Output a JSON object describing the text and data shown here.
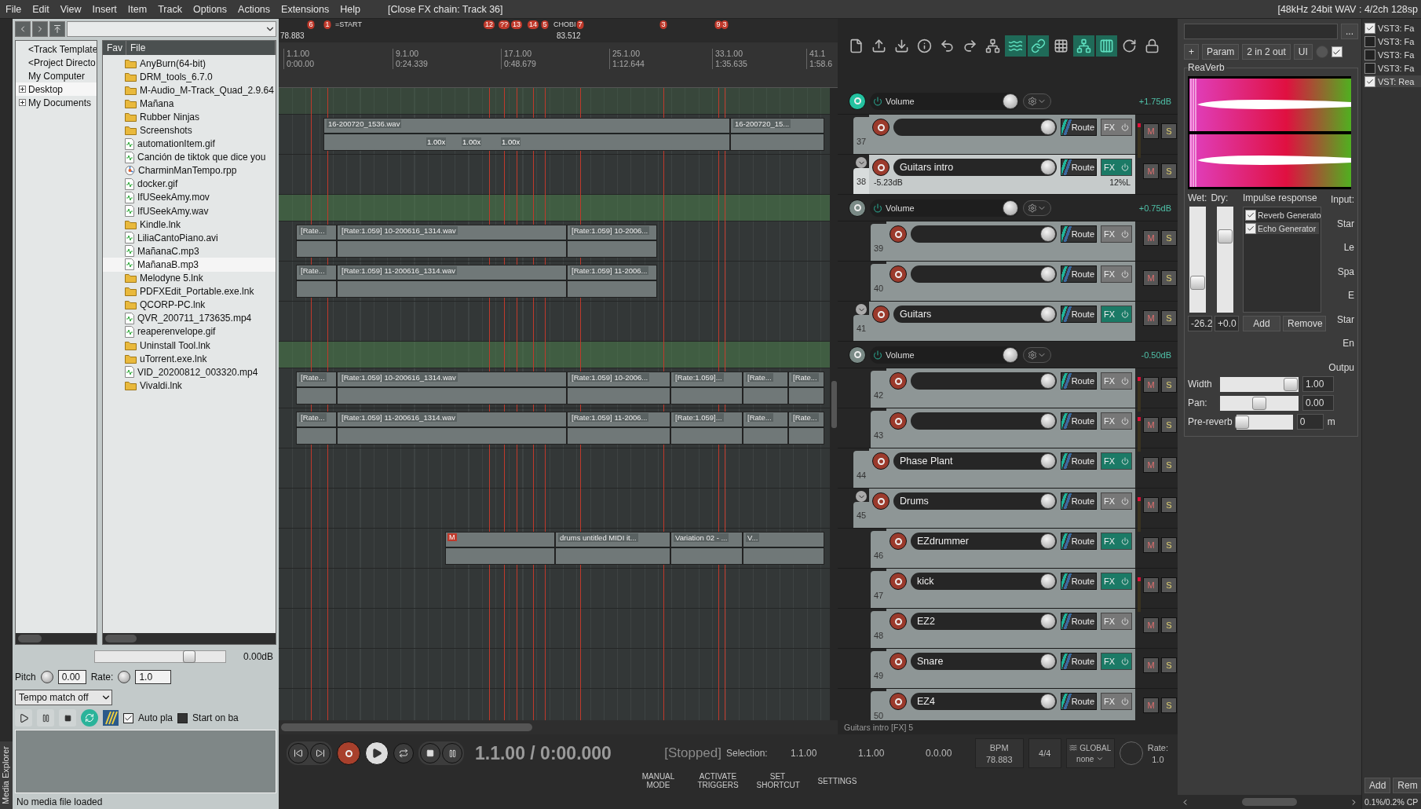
{
  "menu": [
    "File",
    "Edit",
    "View",
    "Insert",
    "Item",
    "Track",
    "Options",
    "Actions",
    "Extensions",
    "Help"
  ],
  "window_title": "[Close FX chain: Track 36]",
  "format_status": "[48kHz 24bit WAV : 4/2ch 128sp",
  "media_explorer": {
    "tab_label": "Media Explorer",
    "columns": [
      "Fav",
      "File"
    ],
    "tree": [
      {
        "label": "<Track Template",
        "expandable": false,
        "selected": false
      },
      {
        "label": "<Project Directo",
        "expandable": false,
        "selected": false
      },
      {
        "label": "My Computer",
        "expandable": false,
        "selected": false
      },
      {
        "label": "Desktop",
        "expandable": true,
        "selected": true
      },
      {
        "label": "My Documents",
        "expandable": true,
        "selected": false
      }
    ],
    "files": [
      {
        "name": "AnyBurn(64-bit)",
        "kind": "folder",
        "selected": false
      },
      {
        "name": "DRM_tools_6.7.0",
        "kind": "folder",
        "selected": false
      },
      {
        "name": "M-Audio_M-Track_Quad_2.9.64",
        "kind": "folder",
        "selected": false
      },
      {
        "name": "Mañana",
        "kind": "folder",
        "selected": false
      },
      {
        "name": "Rubber Ninjas",
        "kind": "folder",
        "selected": false
      },
      {
        "name": "Screenshots",
        "kind": "folder",
        "selected": false
      },
      {
        "name": "automationItem.gif",
        "kind": "media",
        "selected": false
      },
      {
        "name": "Canción de tiktok que dice you",
        "kind": "media",
        "selected": false
      },
      {
        "name": "CharminManTempo.rpp",
        "kind": "project",
        "selected": false
      },
      {
        "name": "docker.gif",
        "kind": "media",
        "selected": false
      },
      {
        "name": "IfUSeekAmy.mov",
        "kind": "media",
        "selected": false
      },
      {
        "name": "IfUSeekAmy.wav",
        "kind": "media",
        "selected": false
      },
      {
        "name": "Kindle.lnk",
        "kind": "folder",
        "selected": false
      },
      {
        "name": "LiliaCantoPiano.avi",
        "kind": "media",
        "selected": false
      },
      {
        "name": "MañanaC.mp3",
        "kind": "media",
        "selected": false
      },
      {
        "name": "MañanaB.mp3",
        "kind": "media",
        "selected": true
      },
      {
        "name": "Melodyne 5.lnk",
        "kind": "folder",
        "selected": false
      },
      {
        "name": "PDFXEdit_Portable.exe.lnk",
        "kind": "folder",
        "selected": false
      },
      {
        "name": "QCORP-PC.lnk",
        "kind": "folder",
        "selected": false
      },
      {
        "name": "QVR_200711_173635.mp4",
        "kind": "media",
        "selected": false
      },
      {
        "name": "reaperenvelope.gif",
        "kind": "media",
        "selected": false
      },
      {
        "name": "Uninstall Tool.lnk",
        "kind": "folder",
        "selected": false
      },
      {
        "name": "uTorrent.exe.lnk",
        "kind": "folder",
        "selected": false
      },
      {
        "name": "VID_20200812_003320.mp4",
        "kind": "media",
        "selected": false
      },
      {
        "name": "Vivaldi.lnk",
        "kind": "folder",
        "selected": false
      }
    ],
    "volume": {
      "level": 0.72,
      "reading": "0.00dB"
    },
    "pitch_label": "Pitch",
    "pitch": "0.00",
    "rate_label": "Rate:",
    "rate": "1.0",
    "tempo_mode": "Tempo match off",
    "auto_play": {
      "label": "Auto pla",
      "checked": true
    },
    "start_on_bar": {
      "label": "Start on ba",
      "checked": false
    },
    "status": "No media file loaded"
  },
  "arrange": {
    "start_tempo": "78.883",
    "tempo_marker": "83.512",
    "markers": [
      {
        "kind": "number",
        "label": "6"
      },
      {
        "kind": "number",
        "label": "1"
      },
      {
        "kind": "text",
        "label": "=START"
      },
      {
        "kind": "number",
        "label": "12"
      },
      {
        "kind": "number",
        "label": "??"
      },
      {
        "kind": "number",
        "label": "13"
      },
      {
        "kind": "number",
        "label": "14"
      },
      {
        "kind": "number",
        "label": "5"
      },
      {
        "kind": "text",
        "label": "CHOBI"
      },
      {
        "kind": "number",
        "label": "7"
      },
      {
        "kind": "number",
        "label": "3"
      },
      {
        "kind": "number",
        "label": "9"
      },
      {
        "kind": "number",
        "label": "3"
      }
    ],
    "ruler": [
      {
        "bar": "1.1.00",
        "time": "0:00.00"
      },
      {
        "bar": "9.1.00",
        "time": "0:24.339"
      },
      {
        "bar": "17.1.00",
        "time": "0:48.679"
      },
      {
        "bar": "25.1.00",
        "time": "1:12.644"
      },
      {
        "bar": "33.1.00",
        "time": "1:35.635"
      },
      {
        "bar": "41.1",
        "time": "1:58.6"
      }
    ]
  },
  "toolbar": [
    {
      "active": false
    },
    {
      "active": false
    },
    {
      "active": false
    },
    {
      "active": false
    },
    {
      "active": false
    },
    {
      "active": false
    },
    {
      "active": false
    },
    {
      "active": true
    },
    {
      "active": true
    },
    {
      "active": false
    },
    {
      "active": true
    },
    {
      "active": true
    },
    {
      "active": false
    },
    {
      "active": false
    }
  ],
  "tracks": [
    {
      "kind": "envelope",
      "label": "Volume",
      "value": "+1.75dB",
      "armed": true
    },
    {
      "kind": "track",
      "number": "37",
      "selected": false,
      "fx_on": false,
      "clip": true,
      "route": "Route",
      "fx": "FX",
      "mute": "M",
      "solo": "S",
      "items": [
        {
          "label": "16-200720_1536.wav",
          "stretch": [
            "1.00x",
            "1.00x",
            "1.00x"
          ]
        },
        {
          "label": "16-200720_15..."
        }
      ]
    },
    {
      "kind": "track",
      "number": "38",
      "name": "Guitars intro",
      "selected": true,
      "fx_on": true,
      "clip": false,
      "route": "Route",
      "fx": "FX",
      "mute": "M",
      "solo": "S",
      "volume": "-5.23dB",
      "pan": "12%L",
      "children": [
        {
          "kind": "envelope",
          "label": "Volume",
          "value": "+0.75dB",
          "armed": false
        },
        {
          "kind": "track",
          "number": "39",
          "selected": false,
          "fx_on": false,
          "clip": false,
          "route": "Route",
          "fx": "FX",
          "mute": "M",
          "solo": "S",
          "items": [
            {
              "label": "[Rate..."
            },
            {
              "label": "[Rate:1.059] 10-200616_1314.wav"
            },
            {
              "label": "[Rate:1.059] 10-2006..."
            }
          ]
        },
        {
          "kind": "track",
          "number": "40",
          "selected": false,
          "fx_on": false,
          "clip": false,
          "route": "Route",
          "fx": "FX",
          "mute": "M",
          "solo": "S",
          "items": [
            {
              "label": "[Rate..."
            },
            {
              "label": "[Rate:1.059] 11-200616_1314.wav"
            },
            {
              "label": "[Rate:1.059] 11-2006..."
            }
          ]
        }
      ]
    },
    {
      "kind": "track",
      "number": "41",
      "name": "Guitars",
      "selected": false,
      "fx_on": true,
      "clip": false,
      "route": "Route",
      "fx": "FX",
      "mute": "M",
      "solo": "S",
      "children": [
        {
          "kind": "envelope",
          "label": "Volume",
          "value": "-0.50dB",
          "armed": false
        },
        {
          "kind": "track",
          "number": "42",
          "selected": false,
          "fx_on": false,
          "clip": true,
          "route": "Route",
          "fx": "FX",
          "mute": "M",
          "solo": "S",
          "items": [
            {
              "label": "[Rate..."
            },
            {
              "label": "[Rate:1.059] 10-200616_1314.wav"
            },
            {
              "label": "[Rate:1.059] 10-2006..."
            },
            {
              "label": "[Rate:1.059]..."
            },
            {
              "label": "[Rate..."
            },
            {
              "label": "[Rate..."
            }
          ]
        },
        {
          "kind": "track",
          "number": "43",
          "selected": false,
          "fx_on": false,
          "clip": true,
          "route": "Route",
          "fx": "FX",
          "mute": "M",
          "solo": "S",
          "items": [
            {
              "label": "[Rate..."
            },
            {
              "label": "[Rate:1.059] 11-200616_1314.wav"
            },
            {
              "label": "[Rate:1.059] 11-2006..."
            },
            {
              "label": "[Rate:1.059]..."
            },
            {
              "label": "[Rate..."
            },
            {
              "label": "[Rate..."
            }
          ]
        }
      ]
    },
    {
      "kind": "track",
      "number": "44",
      "name": "Phase Plant",
      "selected": false,
      "fx_on": true,
      "clip": false,
      "route": "Route",
      "fx": "FX",
      "mute": "M",
      "solo": "S"
    },
    {
      "kind": "track",
      "number": "45",
      "name": "Drums",
      "selected": false,
      "fx_on": false,
      "clip": true,
      "route": "Route",
      "fx": "FX",
      "mute": "M",
      "solo": "S",
      "children": [
        {
          "kind": "track",
          "number": "46",
          "name": "EZdrummer",
          "selected": false,
          "fx_on": true,
          "clip": false,
          "route": "Route",
          "fx": "FX",
          "mute": "M",
          "solo": "S",
          "items": [
            {
              "muted": "M"
            },
            {
              "label": "drums untitled MIDI it..."
            },
            {
              "label": "Variation 02 - ..."
            },
            {
              "label": "V..."
            }
          ]
        },
        {
          "kind": "track",
          "number": "47",
          "name": "kick",
          "selected": false,
          "fx_on": true,
          "clip": true,
          "route": "Route",
          "fx": "FX",
          "mute": "M",
          "solo": "S"
        },
        {
          "kind": "track",
          "number": "48",
          "name": "EZ2",
          "selected": false,
          "fx_on": false,
          "clip": false,
          "route": "Route",
          "fx": "FX",
          "mute": "M",
          "solo": "S"
        },
        {
          "kind": "track",
          "number": "49",
          "name": "Snare",
          "selected": false,
          "fx_on": true,
          "clip": false,
          "route": "Route",
          "fx": "FX",
          "mute": "M",
          "solo": "S"
        },
        {
          "kind": "track",
          "number": "50",
          "name": "EZ4",
          "selected": false,
          "fx_on": false,
          "clip": false,
          "route": "Route",
          "fx": "FX",
          "mute": "M",
          "solo": "S"
        }
      ]
    }
  ],
  "fx_status": "Guitars intro [FX] 5",
  "transport": {
    "time": "1.1.00 / 0:00.000",
    "state": "[Stopped]",
    "selection_label": "Selection:",
    "selection": [
      "1.1.00",
      "1.1.00",
      "0.0.00"
    ],
    "bpm_label": "BPM",
    "bpm": "78.883",
    "signature": "4/4",
    "global_label": "GLOBAL",
    "global_mode": "none",
    "rate_label": "Rate:",
    "rate": "1.0"
  },
  "actions": [
    "MANUAL MODE",
    "ACTIVATE TRIGGERS",
    "SET SHORTCUT",
    "SETTINGS"
  ],
  "fx": {
    "more": "...",
    "buttons": [
      "+",
      "Param",
      "2 in 2 out",
      "UI"
    ],
    "enabled": true,
    "plugin_name": "ReaVerb",
    "wet_label": "Wet:",
    "dry_label": "Dry:",
    "ir_label": "Impulse response",
    "wet": {
      "level": 0.28,
      "value": "-26.2"
    },
    "dry": {
      "level": 0.72,
      "value": "+0.0"
    },
    "generators": [
      {
        "label": "Reverb Generato",
        "checked": true,
        "selected": false
      },
      {
        "label": "Echo Generator",
        "checked": true,
        "selected": true
      }
    ],
    "add": "Add",
    "remove": "Remove",
    "side_labels": [
      "Input:",
      "Star",
      "Le",
      "Spa",
      "E",
      "Star",
      "En",
      "Outpu"
    ],
    "width": {
      "label": "Width",
      "level": 0.9,
      "value": "1.00"
    },
    "pan": {
      "label": "Pan:",
      "level": 0.5,
      "value": "0.00"
    },
    "prereverb": {
      "label": "Pre-reverb",
      "level": 0.1,
      "value": "0",
      "unit": "m"
    }
  },
  "fx_chain": {
    "items": [
      {
        "label": "VST3: Fa",
        "checked": true,
        "selected": false
      },
      {
        "label": "VST3: Fa",
        "checked": false,
        "selected": false
      },
      {
        "label": "VST3: Fa",
        "checked": false,
        "selected": false
      },
      {
        "label": "VST3: Fa",
        "checked": false,
        "selected": false
      },
      {
        "label": "VST: Rea",
        "checked": true,
        "selected": true
      }
    ],
    "add": "Add",
    "remove": "Rem",
    "cpu": "0.1%/0.2% CP"
  }
}
